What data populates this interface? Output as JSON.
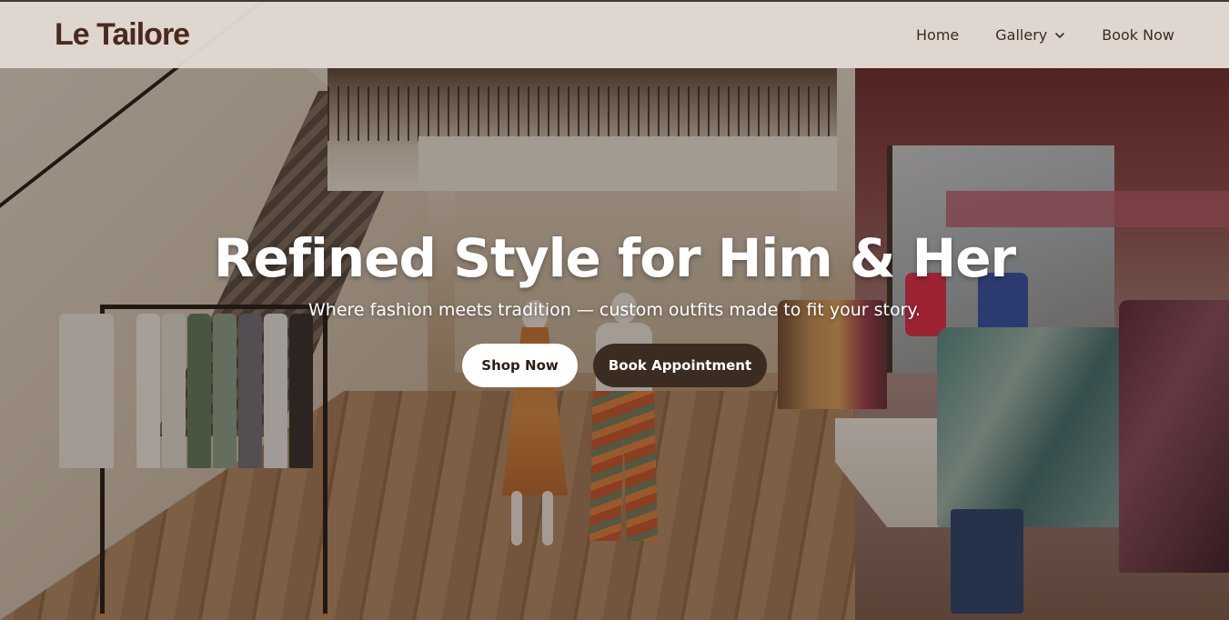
{
  "header": {
    "logo": "Le Tailore",
    "nav": [
      {
        "label": "Home"
      },
      {
        "label": "Gallery",
        "has_dropdown": true
      },
      {
        "label": "Book Now"
      }
    ]
  },
  "hero": {
    "title": "Refined Style for Him & Her",
    "subtitle": "Where fashion meets tradition — custom outfits made to fit your story.",
    "primary_button": "Shop Now",
    "secondary_button": "Book Appointment",
    "background_image": "boutique-interior-photo"
  },
  "colors": {
    "brand": "#4a2a1f",
    "header_bg": "#e2dad2",
    "button_dark": "#3b2c22",
    "button_light": "#ffffff"
  }
}
